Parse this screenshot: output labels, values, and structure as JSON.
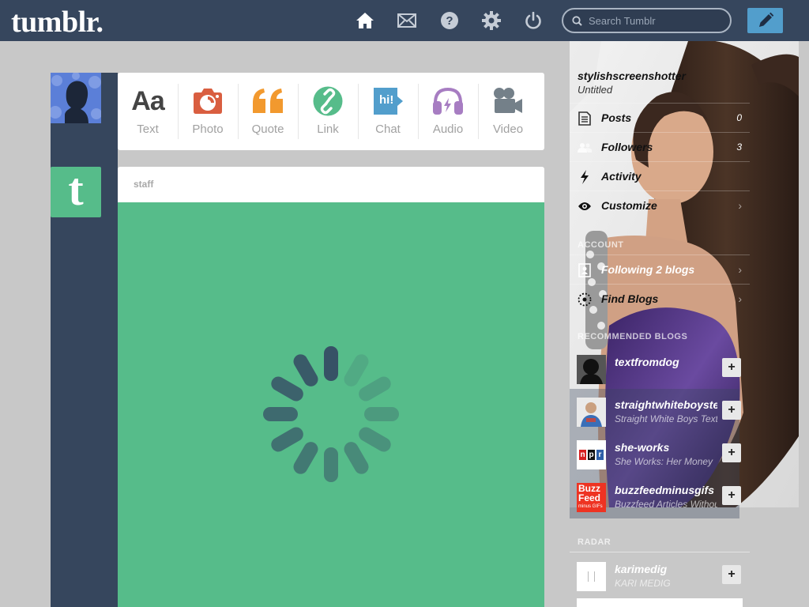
{
  "app": {
    "logo": "tumblr."
  },
  "header": {
    "nav": [
      "home-icon",
      "mail-icon",
      "help-icon",
      "settings-icon",
      "power-icon"
    ],
    "search_placeholder": "Search Tumblr",
    "compose_icon": "pencil-icon"
  },
  "post_types": [
    {
      "label": "Text",
      "glyph": "Aa",
      "icon": "text-icon",
      "color": "#444444"
    },
    {
      "label": "Photo",
      "icon": "camera-icon",
      "color": "#d95e40"
    },
    {
      "label": "Quote",
      "glyph": "““",
      "icon": "quote-icon",
      "color": "#f2992e"
    },
    {
      "label": "Link",
      "icon": "link-icon",
      "color": "#56bc8a"
    },
    {
      "label": "Chat",
      "glyph": "hi!",
      "icon": "chat-icon",
      "color": "#529ecc"
    },
    {
      "label": "Audio",
      "icon": "headphones-icon",
      "color": "#a77dc2"
    },
    {
      "label": "Video",
      "icon": "video-camera-icon",
      "color": "#748089"
    }
  ],
  "post": {
    "username": "staff",
    "avatar_letter": "t"
  },
  "sidebar": {
    "blog_name": "stylishscreenshotter",
    "blog_title": "Untitled",
    "stats": [
      {
        "label": "Posts",
        "count": "0",
        "icon": "document-icon"
      },
      {
        "label": "Followers",
        "count": "3",
        "icon": "people-icon"
      },
      {
        "label": "Activity",
        "icon": "lightning-icon"
      },
      {
        "label": "Customize",
        "icon": "eye-icon",
        "chevron": "›"
      }
    ],
    "account_header": "ACCOUNT",
    "account": [
      {
        "label": "Following 2 blogs",
        "icon": "contacts-icon",
        "chevron": "›"
      },
      {
        "label": "Find Blogs",
        "icon": "compass-icon",
        "chevron": "›"
      }
    ],
    "recommended_header": "RECOMMENDED BLOGS",
    "recommended": [
      {
        "name": "textfromdog",
        "sub": ""
      },
      {
        "name": "straightwhiteboystexting",
        "sub": "Straight White Boys Texting"
      },
      {
        "name": "she-works",
        "sub": "She Works: Her Money"
      },
      {
        "name": "buzzfeedminusgifs",
        "sub": "Buzzfeed Articles Without GIFs"
      }
    ],
    "radar_header": "RADAR",
    "radar": {
      "name": "karimedig",
      "sub": "KARI MEDIG"
    },
    "plus": "+",
    "buzzfeed_logo": [
      "Buzz",
      "Feed",
      "minus GIFs"
    ],
    "npr_logo": [
      "n",
      "p",
      "r"
    ]
  },
  "colors": {
    "navy": "#36465d",
    "green": "#56bc8a",
    "blue": "#529ecc",
    "background": "#c8c8c8"
  }
}
